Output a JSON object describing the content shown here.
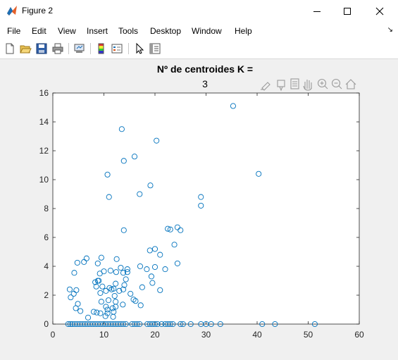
{
  "window": {
    "title": "Figure 2",
    "minimize_icon": "minimize-icon",
    "maximize_icon": "maximize-icon",
    "close_icon": "close-icon"
  },
  "menu": {
    "items": [
      "File",
      "Edit",
      "View",
      "Insert",
      "Tools",
      "Desktop",
      "Window",
      "Help"
    ],
    "overflow_icon": "dock-arrow-icon"
  },
  "toolbar": {
    "icons": [
      "new-figure-icon",
      "open-file-icon",
      "save-icon",
      "print-icon",
      "link-plot-icon",
      "insert-colorbar-icon",
      "insert-legend-icon",
      "edit-plot-icon",
      "property-inspector-icon"
    ]
  },
  "axes_toolbar": {
    "icons": [
      "brush-icon",
      "data-tips-icon",
      "restore-view-icon",
      "pan-icon",
      "zoom-in-icon",
      "zoom-out-icon",
      "home-icon"
    ]
  },
  "chart_data": {
    "type": "scatter",
    "title": [
      "Nº de centroides K =",
      "3"
    ],
    "xlabel": "",
    "ylabel": "",
    "xlim": [
      0,
      60
    ],
    "ylim": [
      0,
      16
    ],
    "xticks": [
      0,
      10,
      20,
      30,
      40,
      50,
      60
    ],
    "yticks": [
      0,
      2,
      4,
      6,
      8,
      10,
      12,
      14,
      16
    ],
    "grid": false,
    "marker": "open-circle",
    "color": "#0072bd",
    "points": [
      [
        35.3,
        15.1
      ],
      [
        13.5,
        13.5
      ],
      [
        20.3,
        12.7
      ],
      [
        16.0,
        11.6
      ],
      [
        13.9,
        11.3
      ],
      [
        10.7,
        10.35
      ],
      [
        40.3,
        10.4
      ],
      [
        19.1,
        9.6
      ],
      [
        17.0,
        9.0
      ],
      [
        11.0,
        8.8
      ],
      [
        29.0,
        8.8
      ],
      [
        29.0,
        8.2
      ],
      [
        13.9,
        6.5
      ],
      [
        24.4,
        6.7
      ],
      [
        22.5,
        6.6
      ],
      [
        23.0,
        6.55
      ],
      [
        25.0,
        6.5
      ],
      [
        23.8,
        5.5
      ],
      [
        20.0,
        5.2
      ],
      [
        19.0,
        5.1
      ],
      [
        21.0,
        4.8
      ],
      [
        12.5,
        4.5
      ],
      [
        9.5,
        4.6
      ],
      [
        4.8,
        4.25
      ],
      [
        6.1,
        4.3
      ],
      [
        6.6,
        4.55
      ],
      [
        8.8,
        4.2
      ],
      [
        24.4,
        4.2
      ],
      [
        17.1,
        4.0
      ],
      [
        14.6,
        3.8
      ],
      [
        20.0,
        3.95
      ],
      [
        13.3,
        3.9
      ],
      [
        22.0,
        3.8
      ],
      [
        18.4,
        3.8
      ],
      [
        10.0,
        3.65
      ],
      [
        11.3,
        3.7
      ],
      [
        12.4,
        3.6
      ],
      [
        14.6,
        3.6
      ],
      [
        13.8,
        3.55
      ],
      [
        4.2,
        3.55
      ],
      [
        9.2,
        3.5
      ],
      [
        19.3,
        3.3
      ],
      [
        14.3,
        3.1
      ],
      [
        9.0,
        3.0
      ],
      [
        8.3,
        2.9
      ],
      [
        8.8,
        3.0
      ],
      [
        19.5,
        2.85
      ],
      [
        12.3,
        2.8
      ],
      [
        8.5,
        2.6
      ],
      [
        9.7,
        2.6
      ],
      [
        11.1,
        2.5
      ],
      [
        14.0,
        2.7
      ],
      [
        13.8,
        2.4
      ],
      [
        11.5,
        2.4
      ],
      [
        11.9,
        2.45
      ],
      [
        17.5,
        2.55
      ],
      [
        3.3,
        2.4
      ],
      [
        4.6,
        2.35
      ],
      [
        10.4,
        2.3
      ],
      [
        13.0,
        2.3
      ],
      [
        21.0,
        2.35
      ],
      [
        15.2,
        2.1
      ],
      [
        9.3,
        2.15
      ],
      [
        4.1,
        2.1
      ],
      [
        12.1,
        1.95
      ],
      [
        3.5,
        1.85
      ],
      [
        15.8,
        1.7
      ],
      [
        16.2,
        1.6
      ],
      [
        10.9,
        1.65
      ],
      [
        9.5,
        1.55
      ],
      [
        12.3,
        1.55
      ],
      [
        4.9,
        1.4
      ],
      [
        10.4,
        1.2
      ],
      [
        11.7,
        1.1
      ],
      [
        4.5,
        1.1
      ],
      [
        12.3,
        1.2
      ],
      [
        17.2,
        1.3
      ],
      [
        13.7,
        1.35
      ],
      [
        10.7,
        1.0
      ],
      [
        5.4,
        0.9
      ],
      [
        11.9,
        0.85
      ],
      [
        8.0,
        0.85
      ],
      [
        8.6,
        0.8
      ],
      [
        9.3,
        0.75
      ],
      [
        10.7,
        0.75
      ],
      [
        11.8,
        0.5
      ],
      [
        6.9,
        0.45
      ],
      [
        10.3,
        0.55
      ],
      [
        3.0,
        0
      ],
      [
        3.4,
        0
      ],
      [
        3.8,
        0
      ],
      [
        4.3,
        0
      ],
      [
        4.8,
        0
      ],
      [
        5.3,
        0
      ],
      [
        5.8,
        0
      ],
      [
        6.3,
        0
      ],
      [
        6.8,
        0
      ],
      [
        7.3,
        0
      ],
      [
        7.8,
        0
      ],
      [
        8.3,
        0
      ],
      [
        8.8,
        0
      ],
      [
        9.3,
        0
      ],
      [
        9.8,
        0
      ],
      [
        10.3,
        0
      ],
      [
        10.8,
        0
      ],
      [
        11.3,
        0
      ],
      [
        11.8,
        0
      ],
      [
        12.3,
        0
      ],
      [
        12.8,
        0
      ],
      [
        13.3,
        0
      ],
      [
        13.8,
        0
      ],
      [
        14.3,
        0
      ],
      [
        15.5,
        0
      ],
      [
        16.0,
        0
      ],
      [
        16.5,
        0
      ],
      [
        17.0,
        0
      ],
      [
        18.5,
        0
      ],
      [
        19.0,
        0
      ],
      [
        19.5,
        0
      ],
      [
        20.0,
        0
      ],
      [
        20.5,
        0
      ],
      [
        21.3,
        0
      ],
      [
        22.0,
        0
      ],
      [
        22.5,
        0
      ],
      [
        23.0,
        0
      ],
      [
        23.5,
        0
      ],
      [
        25.0,
        0
      ],
      [
        25.5,
        0
      ],
      [
        27.0,
        0
      ],
      [
        29.0,
        0
      ],
      [
        30.0,
        0
      ],
      [
        31.0,
        0
      ],
      [
        32.8,
        0
      ],
      [
        41.0,
        0
      ],
      [
        43.5,
        0
      ],
      [
        51.3,
        0
      ]
    ]
  }
}
